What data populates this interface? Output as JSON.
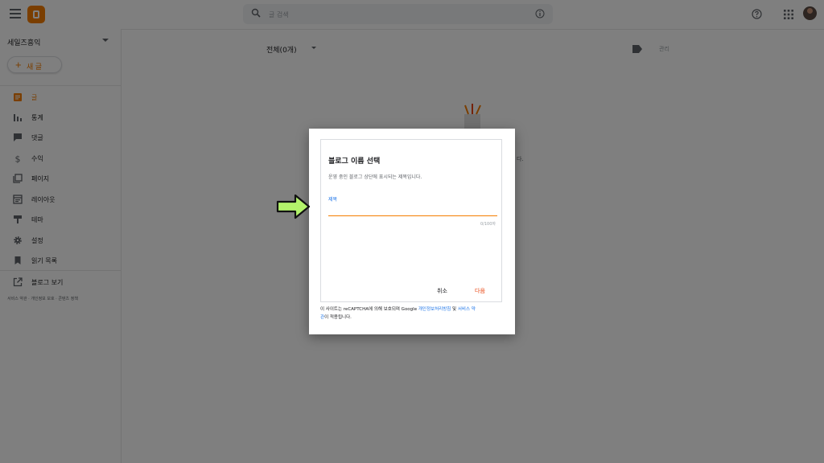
{
  "search": {
    "placeholder": "글 검색"
  },
  "sidebar": {
    "blog_name": "세일즈흥익",
    "new_post_label": "새 글",
    "items": [
      {
        "label": "글",
        "icon": "posts-icon",
        "active": true
      },
      {
        "label": "통계",
        "icon": "stats-icon",
        "active": false
      },
      {
        "label": "댓글",
        "icon": "comments-icon",
        "active": false
      },
      {
        "label": "수익",
        "icon": "earnings-icon",
        "active": false
      },
      {
        "label": "페이지",
        "icon": "pages-icon",
        "active": false
      },
      {
        "label": "레이아웃",
        "icon": "layout-icon",
        "active": false
      },
      {
        "label": "테마",
        "icon": "theme-icon",
        "active": false
      },
      {
        "label": "설정",
        "icon": "settings-icon",
        "active": false
      },
      {
        "label": "읽기 목록",
        "icon": "reading-list-icon",
        "active": false
      }
    ],
    "view_blog_label": "블로그 보기",
    "footer_links": [
      "서비스 약관",
      "개인정보 보호",
      "콘텐츠 정책"
    ]
  },
  "main": {
    "filter_label": "전체(0개)",
    "manage_label": "관리",
    "empty_state_fragment": "다."
  },
  "dialog": {
    "title": "블로그 이름 선택",
    "description": "운영 중인 블로그 상단에 표시되는 제목입니다.",
    "field_label": "제목",
    "input_value": "",
    "char_count": "0/100자",
    "cancel_label": "취소",
    "next_label": "다음",
    "recaptcha_text_1": "이 사이트는 reCAPTCHA에 의해 보호되며 Google ",
    "privacy_link": "개인정보처리방침",
    "and_text": " 및 ",
    "terms_link_1": "서비스 약",
    "terms_link_2": "관",
    "recaptcha_text_2": "이 적용됩니다."
  },
  "colors": {
    "accent": "#f57d00",
    "link": "#1a73e8",
    "next_button": "#e8430f",
    "annotation_arrow": "#b3f26b"
  }
}
